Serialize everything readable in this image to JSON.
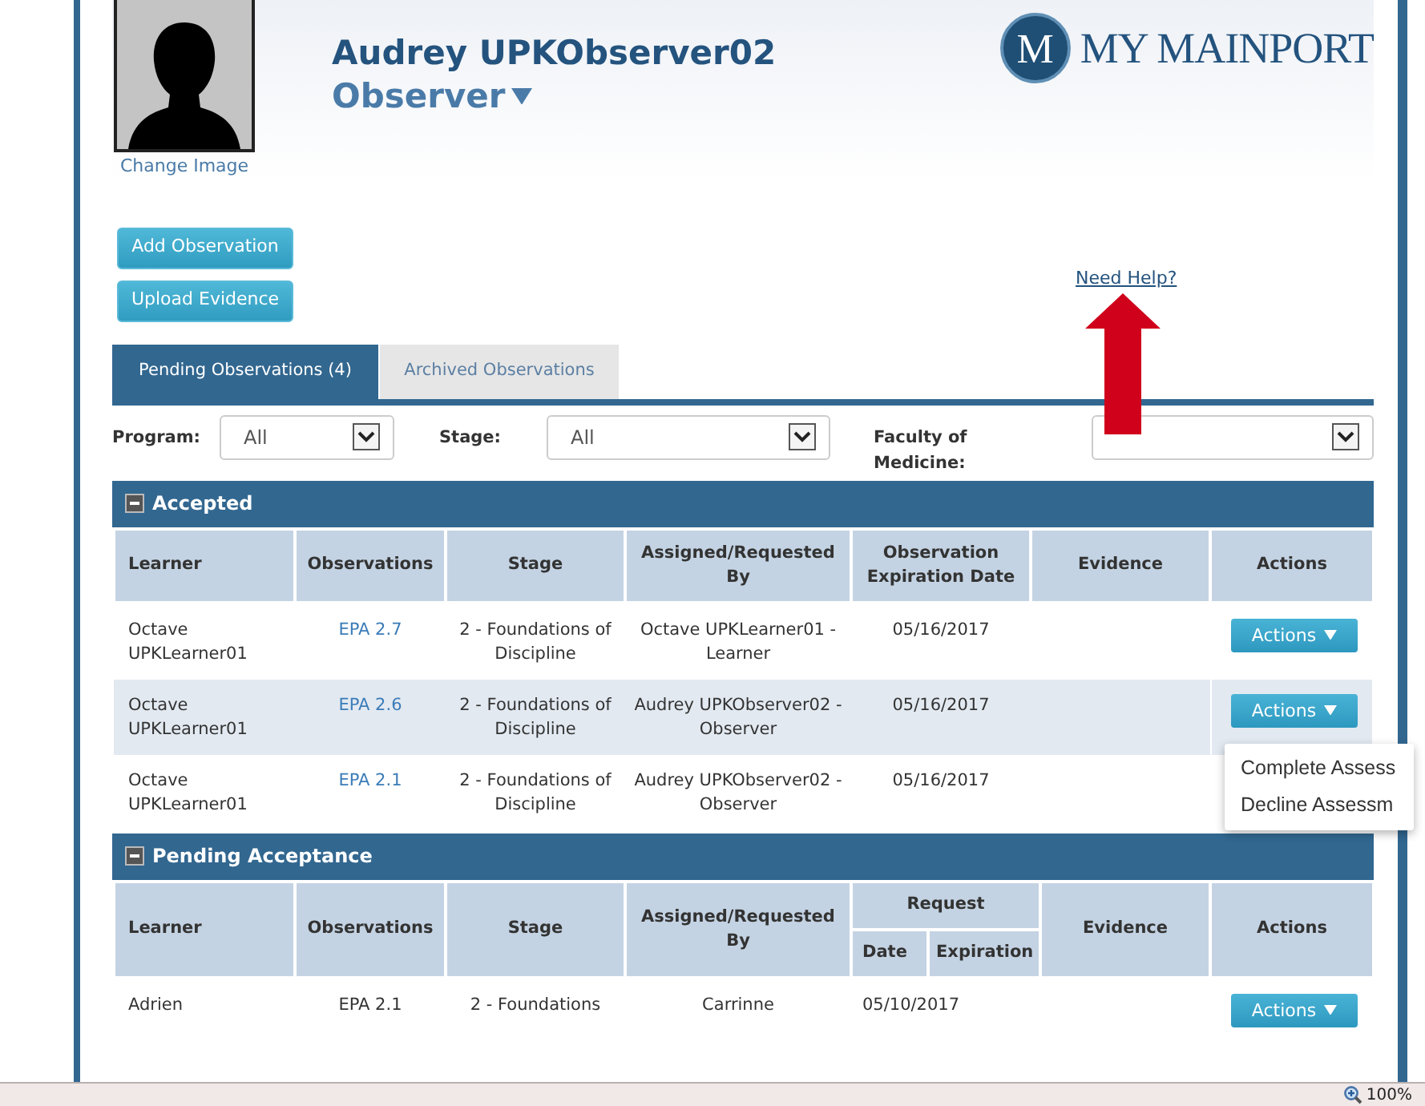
{
  "profile": {
    "name": "Audrey UPKObserver02",
    "role": "Observer",
    "change_image": "Change Image"
  },
  "logo": {
    "mark": "M",
    "text": "MY MAINPORT"
  },
  "buttons": [
    "Add Observation",
    "Upload Evidence"
  ],
  "help_link": "Need Help?",
  "tabs": [
    {
      "label": "Pending Observations (4)",
      "selected": true
    },
    {
      "label": "Archived Observations",
      "selected": false
    }
  ],
  "filters": [
    {
      "label": "Program:",
      "value": "All"
    },
    {
      "label": "Stage:",
      "value": "All"
    },
    {
      "label": "Faculty of Medicine:"
    }
  ],
  "sections": [
    {
      "title": "Accepted",
      "expanded": true,
      "kind": "accepted",
      "columns": [
        "Learner",
        "Observations",
        "Stage",
        "Assigned/Requested By",
        "Observation Expiration Date",
        "Evidence",
        "Actions"
      ],
      "rows": [
        {
          "learner": "Octave UPKLearner01",
          "observation": "EPA 2.7",
          "stage": "2 - Foundations of Discipline",
          "assigned_by": "Octave UPKLearner01 - Learner",
          "dates": [
            "05/16/2017"
          ],
          "actions": "Actions"
        },
        {
          "learner": "Octave UPKLearner01",
          "observation": "EPA 2.6",
          "stage": "2 - Foundations of Discipline",
          "assigned_by": "Audrey UPKObserver02 - Observer",
          "dates": [
            "05/16/2017"
          ],
          "actions": "Actions",
          "menu": [
            "Complete Assess",
            "Decline Assessm"
          ]
        },
        {
          "learner": "Octave UPKLearner01",
          "observation": "EPA 2.1",
          "stage": "2 - Foundations of Discipline",
          "assigned_by": "Audrey UPKObserver02 - Observer",
          "dates": [
            "05/16/2017"
          ]
        }
      ]
    },
    {
      "title": "Pending Acceptance",
      "expanded": true,
      "kind": "pending",
      "columns": [
        "Learner",
        "Observations",
        "Stage",
        "Assigned/Requested By",
        {
          "label": "Request",
          "children": [
            "Date",
            "Expiration"
          ]
        },
        "Evidence",
        "Actions"
      ],
      "rows": [
        {
          "learner": "Adrien",
          "observation": "EPA 2.1",
          "stage": "2 - Foundations",
          "assigned_by": "Carrinne",
          "dates": [
            "05/10/2017"
          ],
          "actions": "Actions"
        }
      ]
    }
  ],
  "status_bar": {
    "zoom": "100%"
  }
}
